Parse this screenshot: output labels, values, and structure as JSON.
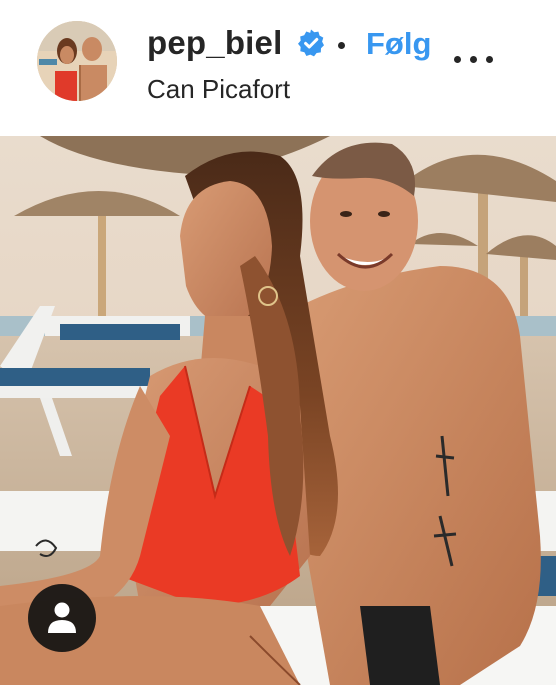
{
  "post_header": {
    "username": "pep_biel",
    "verified": true,
    "separator": "•",
    "follow_label": "Følg",
    "location": "Can Picafort",
    "more_icon": "more-horizontal-icon"
  },
  "post_media": {
    "type": "photo",
    "tag_icon": "user-tag-icon"
  },
  "colors": {
    "follow_blue": "#3897f0",
    "verified_blue": "#3897f0",
    "text_dark": "#262626"
  }
}
